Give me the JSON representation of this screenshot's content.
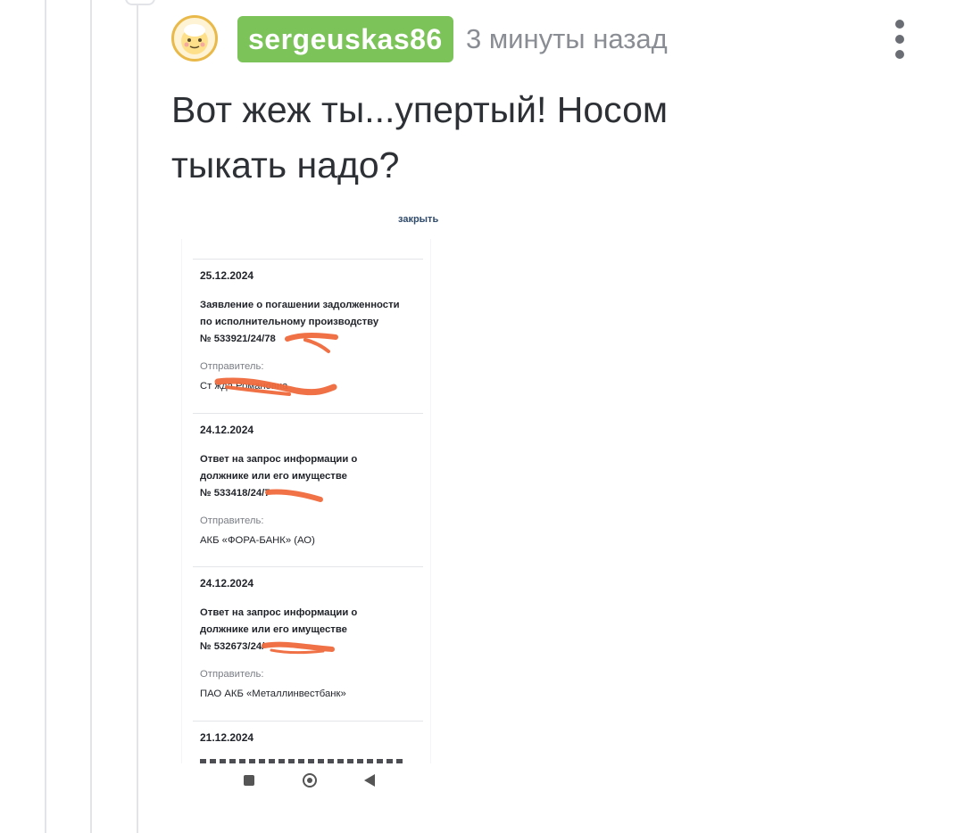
{
  "comment": {
    "username": "sergeuskas86",
    "timestamp": "3 минуты назад",
    "text": "Вот жеж ты...упертый! Носом тыкать надо?",
    "more_icon": "vertical-ellipsis-icon",
    "avatar_icon": "cartoon-face-avatar-icon"
  },
  "screenshot": {
    "close_label": "закрыть",
    "documents": [
      {
        "date": "25.12.2024",
        "title_line1": "Заявление о погашении задолженности",
        "title_line2": "по исполнительному производству",
        "number": "№ 533921/24/78",
        "sender_label": "Отправитель:",
        "sender": "Ст                  жда Романовна"
      },
      {
        "date": "24.12.2024",
        "title_line1": "Ответ на запрос информации о",
        "title_line2": "должнике или его имуществе",
        "number": "№ 533418/24/7",
        "sender_label": "Отправитель:",
        "sender": "АКБ «ФОРА-БАНК» (АО)"
      },
      {
        "date": "24.12.2024",
        "title_line1": "Ответ на запрос информации о",
        "title_line2": "должнике или его имуществе",
        "number": "№ 532673/24/",
        "sender_label": "Отправитель:",
        "sender": "ПАО АКБ «Металлинвестбанк»"
      },
      {
        "date": "21.12.2024"
      }
    ],
    "navbar_icons": [
      "recent-apps-icon",
      "home-icon",
      "back-icon"
    ]
  },
  "colors": {
    "username_badge": "#7cc35a",
    "redaction": "#f06a3c",
    "timestamp": "#8a8e94"
  }
}
